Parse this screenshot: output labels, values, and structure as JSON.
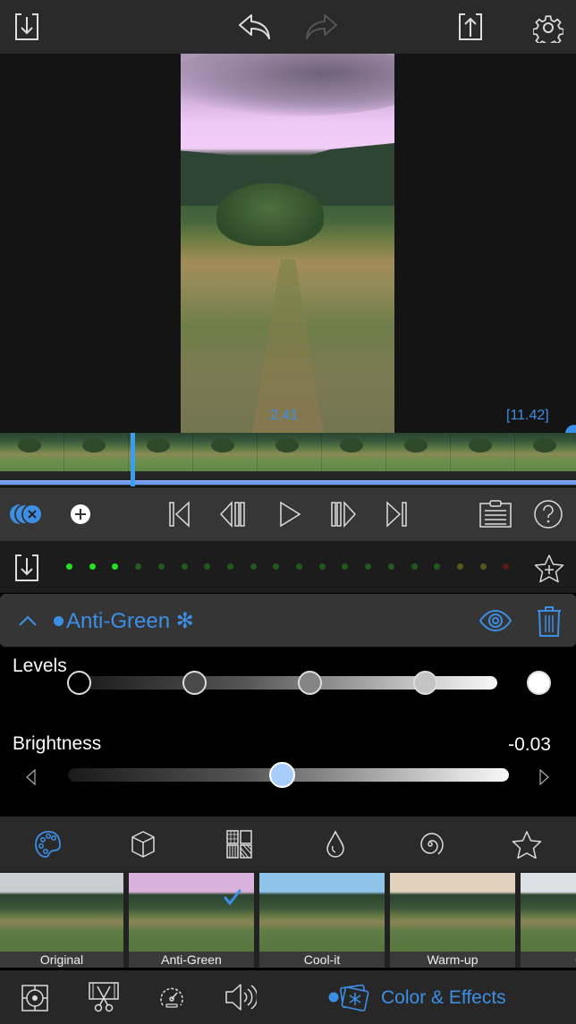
{
  "topbar": {
    "icons": [
      "import-icon",
      "undo-icon",
      "redo-icon",
      "export-icon",
      "settings-icon"
    ]
  },
  "preview": {
    "current_time": "2.41",
    "total_time": "[11.42]"
  },
  "transport": {
    "icons": [
      "layers-close-icon",
      "add-clip-icon",
      "skip-to-start-icon",
      "step-back-icon",
      "play-icon",
      "step-forward-icon",
      "skip-to-end-icon",
      "clipboard-icon",
      "help-icon"
    ]
  },
  "meter": {
    "dots": [
      "#22e21f",
      "#22e21f",
      "#22e21f",
      "#1f5a1f",
      "#1f5a1f",
      "#1f5a1f",
      "#1f5a1f",
      "#1f5a1f",
      "#1f5a1f",
      "#1f5a1f",
      "#1f5a1f",
      "#1f5a1f",
      "#1f5a1f",
      "#1f5a1f",
      "#1f5a1f",
      "#1f5a1f",
      "#1f5a1f",
      "#5a5518",
      "#5a5518",
      "#5a1a18"
    ]
  },
  "effect": {
    "name": "Anti-Green",
    "modified_symbol": "✻"
  },
  "controls": {
    "levels_label": "Levels",
    "levels_values": [
      0.0,
      0.25,
      0.5,
      0.75,
      1.0
    ],
    "brightness_label": "Brightness",
    "brightness_value": "-0.03",
    "brightness_fraction": 0.485
  },
  "categories": [
    "palette-icon",
    "cube-icon",
    "texture-grid-icon",
    "drop-icon",
    "spiral-icon",
    "star-icon"
  ],
  "presets": [
    {
      "label": "Original",
      "sky": "#c9cdd2"
    },
    {
      "label": "Anti-Green",
      "sky": "#d8b1dc",
      "selected": true
    },
    {
      "label": "Cool-it",
      "sky": "#8fc3e8"
    },
    {
      "label": "Warm-up",
      "sky": "#e2d2bd"
    },
    {
      "label": "Co",
      "sky": "#dde0e4"
    }
  ],
  "bottom_bar": {
    "active_label": "Color & Effects"
  },
  "colors": {
    "accent": "#3d8fe6"
  }
}
